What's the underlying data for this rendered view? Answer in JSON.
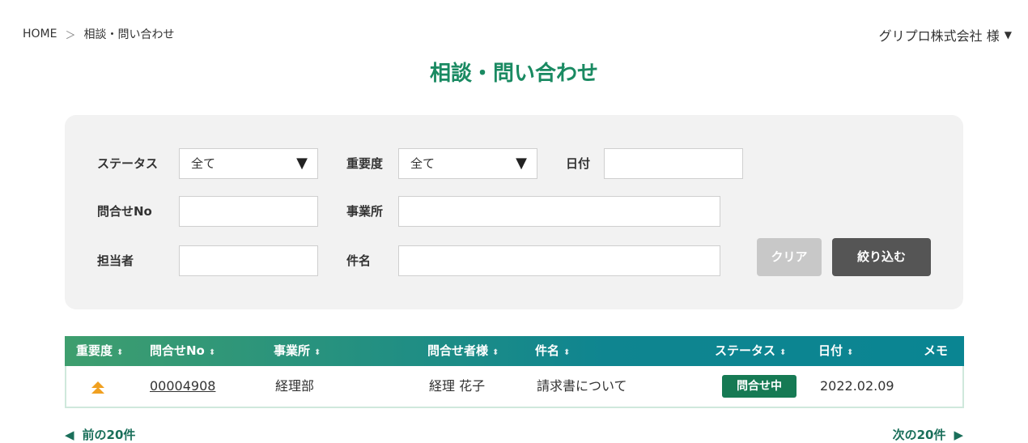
{
  "breadcrumb": {
    "home": "HOME",
    "separator": "＞",
    "current": "相談・問い合わせ"
  },
  "account": {
    "name": "グリプロ株式会社 様",
    "caret": "▼"
  },
  "page_title": "相談・問い合わせ",
  "filters": {
    "status_label": "ステータス",
    "status_value": "全て",
    "priority_label": "重要度",
    "priority_value": "全て",
    "date_label": "日付",
    "date_value": "",
    "inquiry_no_label": "問合せNo",
    "inquiry_no_value": "",
    "office_label": "事業所",
    "office_value": "",
    "assignee_label": "担当者",
    "assignee_value": "",
    "subject_label": "件名",
    "subject_value": "",
    "select_arrow": "▼",
    "clear_label": "クリア",
    "filter_label": "絞り込む"
  },
  "table": {
    "headers": [
      "重要度",
      "問合せNo",
      "事業所",
      "問合せ者様",
      "件名",
      "ステータス",
      "日付",
      "メモ"
    ],
    "sort_icon": "⬍",
    "rows": [
      {
        "priority": "high",
        "inquiry_no": "00004908",
        "office": "経理部",
        "contact": "経理 花子",
        "subject": "請求書について",
        "status": "問合せ中",
        "date": "2022.02.09",
        "memo": ""
      }
    ]
  },
  "pager": {
    "prev_label": "前の20件",
    "next_label": "次の20件",
    "prev_icon": "◀",
    "next_icon": "▶"
  },
  "colors": {
    "accent": "#1a8a62",
    "header_start": "#3e9e6e",
    "header_end": "#0a8592",
    "badge": "#167a54",
    "priority_high": "#f0a020"
  }
}
